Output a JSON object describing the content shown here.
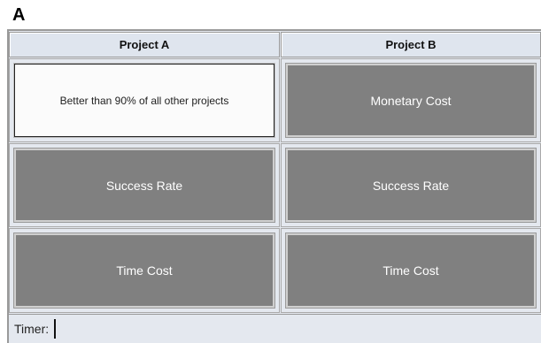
{
  "panel_label": "A",
  "headers": {
    "project_a": "Project A",
    "project_b": "Project B"
  },
  "cells": {
    "a_monetary": "Better than 90% of all other projects",
    "b_monetary": "Monetary Cost",
    "a_success": "Success Rate",
    "b_success": "Success Rate",
    "a_time": "Time Cost",
    "b_time": "Time Cost"
  },
  "timer": {
    "label": "Timer:"
  },
  "colors": {
    "hidden_box": "#808080",
    "revealed_box": "#fbfbfb",
    "frame_bg": "#e4e8ef"
  }
}
